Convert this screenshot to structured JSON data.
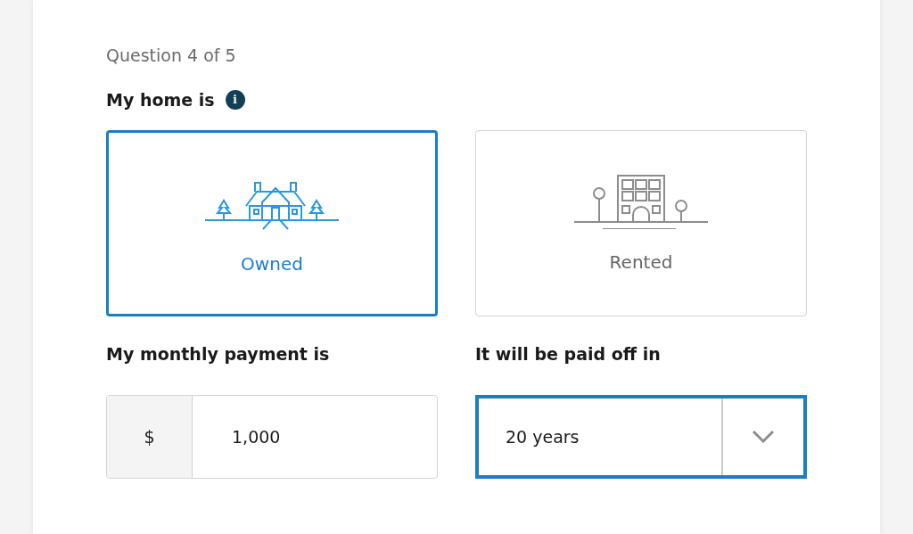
{
  "progress": "Question 4 of 5",
  "question": {
    "label": "My home is",
    "info_icon": "i"
  },
  "options": [
    {
      "kind": "house",
      "label": "Owned",
      "selected": true
    },
    {
      "kind": "building",
      "label": "Rented",
      "selected": false
    }
  ],
  "payment": {
    "label": "My monthly payment is",
    "prefix": "$",
    "value": "1,000"
  },
  "payoff": {
    "label": "It will be paid off in",
    "value": "20 years",
    "focused": true
  }
}
